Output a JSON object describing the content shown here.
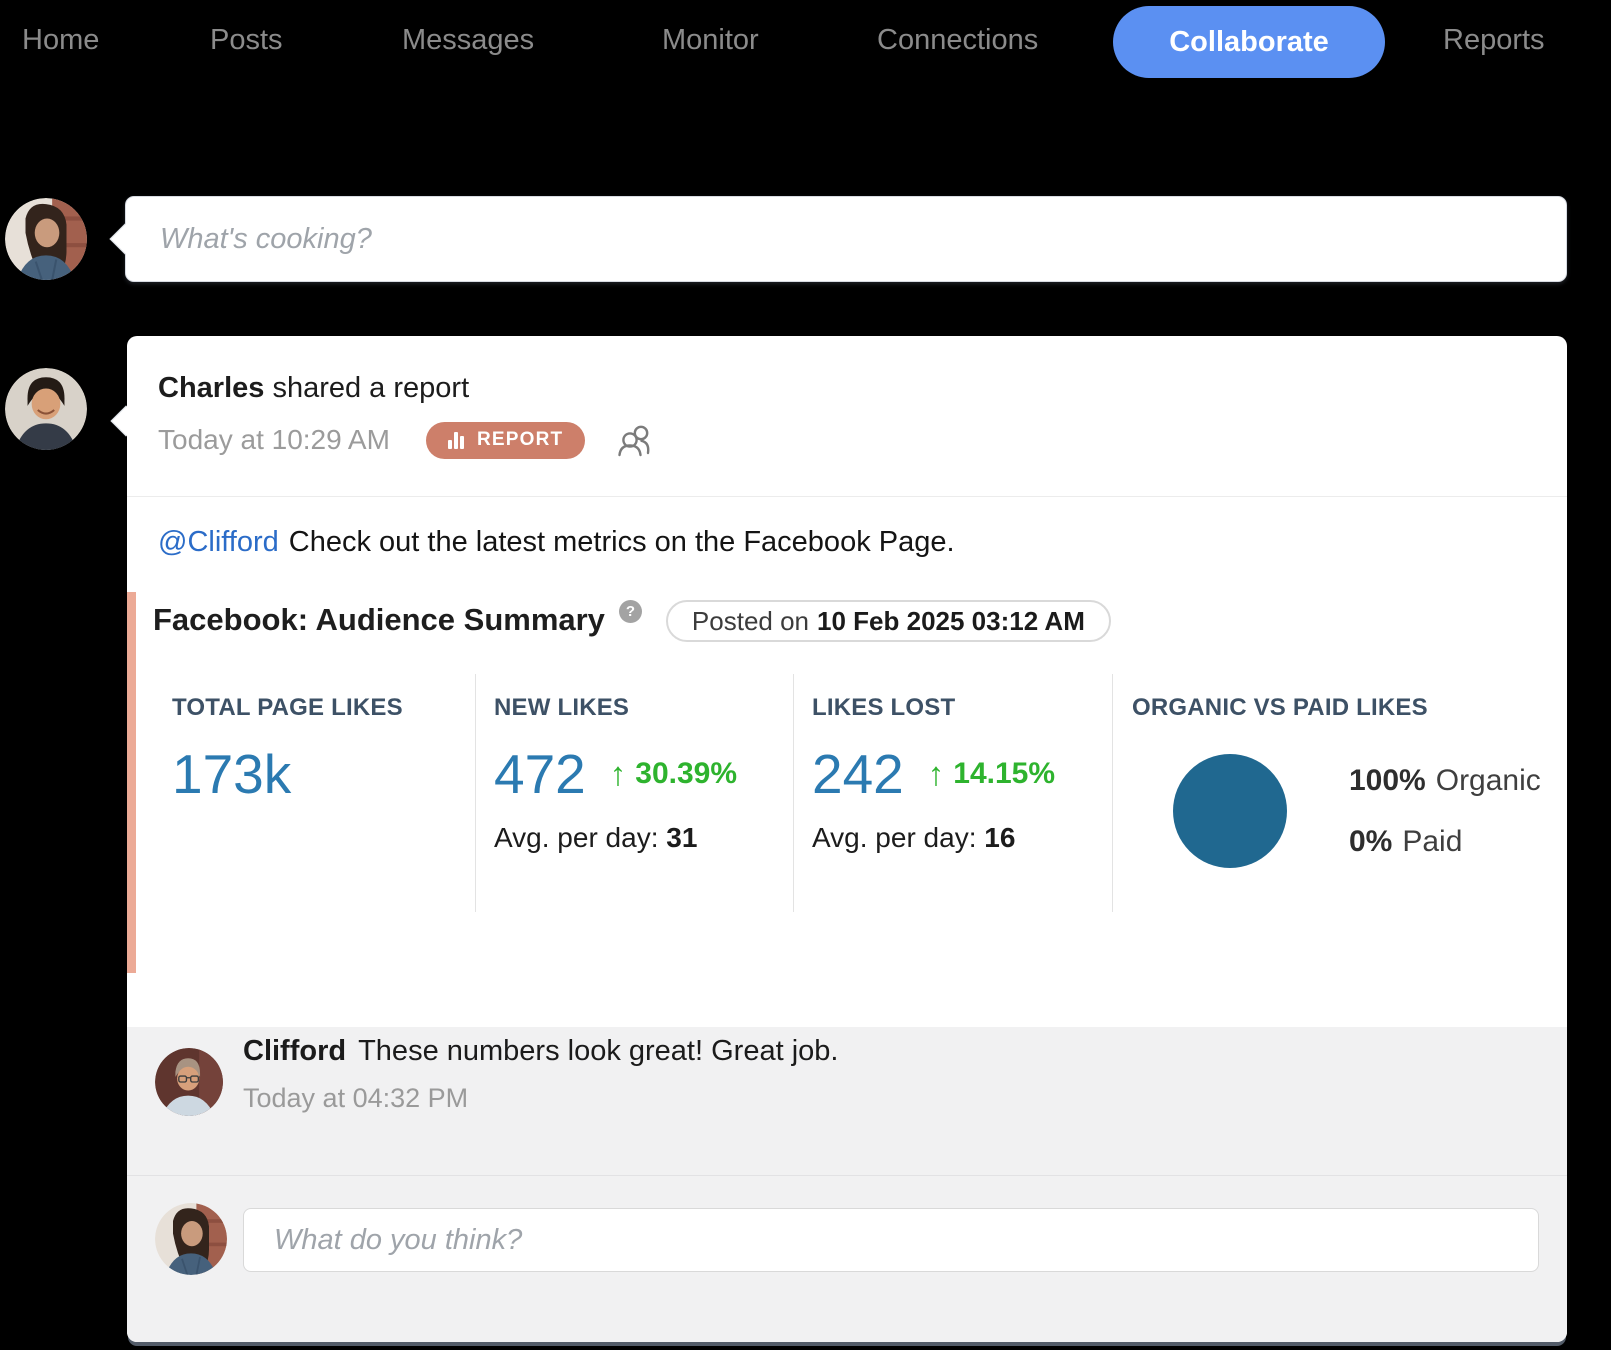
{
  "nav": {
    "items": [
      "Home",
      "Posts",
      "Messages",
      "Monitor",
      "Connections",
      "Collaborate",
      "Reports"
    ],
    "active": "Collaborate"
  },
  "composer": {
    "placeholder": "What's cooking?"
  },
  "post": {
    "author": "Charles",
    "action": "shared a report",
    "timestamp": "Today at 10:29 AM",
    "badge_label": "REPORT",
    "mention": "@Clifford",
    "message": "Check out the latest metrics on the Facebook Page.",
    "report": {
      "title": "Facebook: Audience Summary",
      "posted_prefix": "Posted on",
      "posted_datetime": "10 Feb 2025 03:12 AM",
      "metrics": [
        {
          "label": "TOTAL PAGE LIKES",
          "value": "173k"
        },
        {
          "label": "NEW LIKES",
          "value": "472",
          "change": "30.39%",
          "avg_label": "Avg. per day:",
          "avg_value": "31"
        },
        {
          "label": "LIKES LOST",
          "value": "242",
          "change": "14.15%",
          "avg_label": "Avg. per day:",
          "avg_value": "16"
        },
        {
          "label": "ORGANIC VS PAID LIKES",
          "legend": [
            {
              "pct": "100%",
              "name": "Organic"
            },
            {
              "pct": "0%",
              "name": "Paid"
            }
          ]
        }
      ]
    }
  },
  "comments": {
    "items": [
      {
        "author": "Clifford",
        "text": "These numbers look great! Great job.",
        "timestamp": "Today at 04:32 PM"
      }
    ],
    "input_placeholder": "What do you think?"
  },
  "icons": {
    "up_arrow": "↑",
    "help": "?"
  },
  "colors": {
    "accent_blue": "#5b90f2",
    "metric_blue": "#2b7ab1",
    "positive_green": "#2eb32e",
    "badge_salmon": "#cd7f6a",
    "accent_bar_salmon": "#ecaa96",
    "pie_blue": "#206890"
  }
}
